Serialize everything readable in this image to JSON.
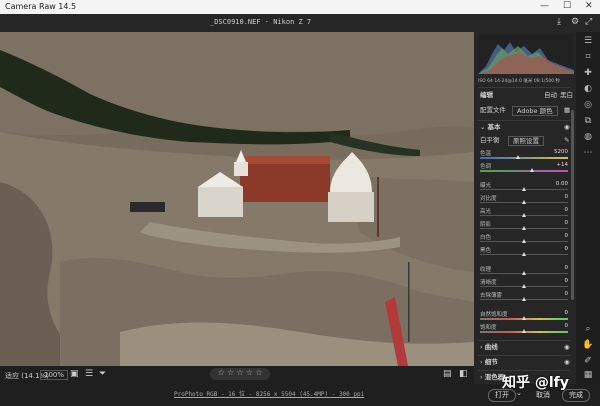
{
  "window": {
    "title": "Camera Raw 14.5",
    "minimize": "—",
    "maximize": "☐",
    "close": "✕"
  },
  "topbar": {
    "filename": "_DSC0910.NEF · Nikon Z 7",
    "save_icon": "save-icon",
    "gear_icon": "gear-icon",
    "fullscreen_icon": "fullscreen-icon"
  },
  "histogram": {
    "readout": "ISO 64   14-24@14.0 毫米   f/8   1/500 秒"
  },
  "panel": {
    "edit_label": "编辑",
    "auto_label": "自动",
    "bw_label": "黑白",
    "profile_label": "配置文件",
    "profile_value": "Adobe 颜色",
    "basic_label": "基本",
    "wb_label": "白平衡",
    "wb_value": "原照设置",
    "sliders_a": [
      {
        "label": "色温",
        "value": "5200"
      },
      {
        "label": "色调",
        "value": "+14"
      }
    ],
    "sliders_b": [
      {
        "label": "曝光",
        "value": "0.00"
      },
      {
        "label": "对比度",
        "value": "0"
      },
      {
        "label": "高光",
        "value": "0"
      },
      {
        "label": "阴影",
        "value": "0"
      },
      {
        "label": "白色",
        "value": "0"
      },
      {
        "label": "黑色",
        "value": "0"
      }
    ],
    "sliders_c": [
      {
        "label": "纹理",
        "value": "0"
      },
      {
        "label": "清晰度",
        "value": "0"
      },
      {
        "label": "去除薄雾",
        "value": "0"
      }
    ],
    "sliders_d": [
      {
        "label": "自然饱和度",
        "value": "0"
      },
      {
        "label": "饱和度",
        "value": "0"
      }
    ],
    "curve_label": "曲线",
    "detail_label": "细节",
    "color_label": "混色器"
  },
  "bottombar": {
    "fit_label": "适应 (14.1%)",
    "zoom": "100%",
    "rating_stars": [
      "☆",
      "☆",
      "☆",
      "☆",
      "☆"
    ]
  },
  "footer": {
    "info": "ProPhoto RGB - 16 位 - 8256 x 5504 (45.4MP) - 300 ppi",
    "open_label": "打开",
    "cancel_label": "取消",
    "done_label": "完成"
  },
  "watermark": "知乎 @lfy",
  "colors": {
    "accent": "#2b7de9",
    "panel_bg": "#262626",
    "temp_gradient_start": "#3a6ac0",
    "temp_gradient_end": "#d8c24a",
    "tint_gradient_start": "#3fae4a",
    "tint_gradient_end": "#c44ac2"
  }
}
